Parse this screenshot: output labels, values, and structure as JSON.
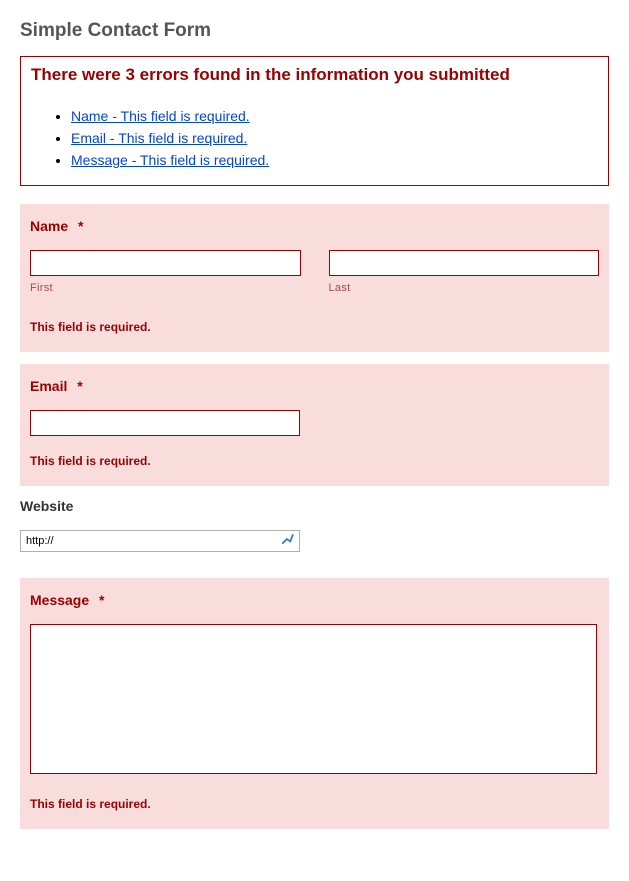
{
  "title": "Simple Contact Form",
  "errorSummary": {
    "heading": "There were 3 errors found in the information you submitted",
    "items": [
      "Name - This field is required.",
      "Email - This field is required.",
      "Message - This field is required."
    ]
  },
  "fields": {
    "name": {
      "label": "Name",
      "required": "*",
      "sublabelFirst": "First",
      "sublabelLast": "Last",
      "error": "This field is required."
    },
    "email": {
      "label": "Email",
      "required": "*",
      "error": "This field is required."
    },
    "website": {
      "label": "Website",
      "value": "http://"
    },
    "message": {
      "label": "Message",
      "required": "*",
      "error": "This field is required."
    }
  }
}
